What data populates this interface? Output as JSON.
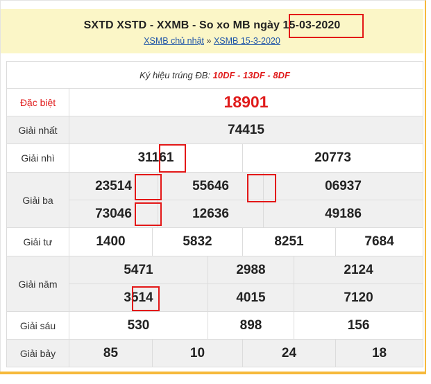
{
  "header": {
    "title_prefix": "SXTD XSTD - XXMB - So xo MB ngày",
    "title_date": "15-03-2020",
    "link1": "XSMB chủ nhật",
    "separator": "»",
    "link2": "XSMB 15-3-2020"
  },
  "symbol": {
    "label": "Ký hiệu trúng ĐB:",
    "codes": "10DF - 13DF - 8DF"
  },
  "prizes": {
    "special": {
      "label": "Đặc biệt",
      "values": [
        "18901"
      ]
    },
    "first": {
      "label": "Giải nhất",
      "values": [
        "74415"
      ]
    },
    "second": {
      "label": "Giải nhì",
      "values": [
        "31161",
        "20773"
      ]
    },
    "third": {
      "label": "Giải ba",
      "values": [
        "23514",
        "55646",
        "06937",
        "73046",
        "12636",
        "49186"
      ]
    },
    "fourth": {
      "label": "Giải tư",
      "values": [
        "1400",
        "5832",
        "8251",
        "7684"
      ]
    },
    "fifth": {
      "label": "Giải năm",
      "values": [
        "5471",
        "2988",
        "2124",
        "3514",
        "4015",
        "7120"
      ]
    },
    "sixth": {
      "label": "Giải sáu",
      "values": [
        "530",
        "898",
        "156"
      ]
    },
    "seventh": {
      "label": "Giải bảy",
      "values": [
        "85",
        "10",
        "24",
        "18"
      ]
    }
  },
  "colors": {
    "accent": "#e01b1b",
    "header_bg": "#fbf6c7",
    "highlight_box": "#e31717",
    "border_orange": "#f6b93b"
  }
}
